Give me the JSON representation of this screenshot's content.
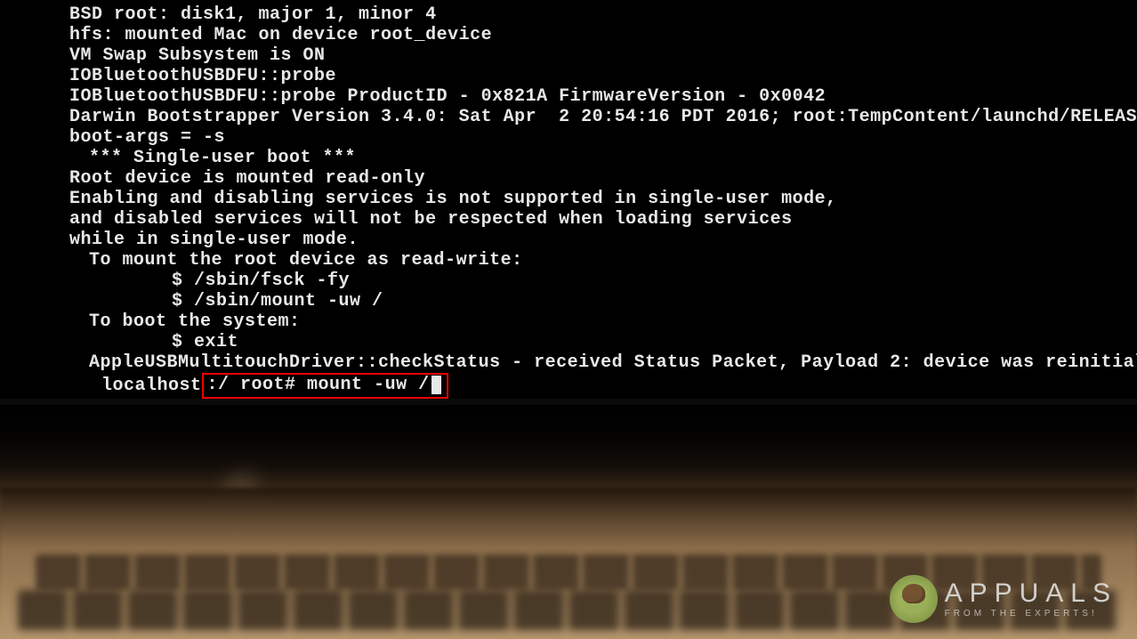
{
  "terminal": {
    "lines": [
      "BSD root: disk1, major 1, minor 4",
      "hfs: mounted Mac on device root_device",
      "VM Swap Subsystem is ON",
      "IOBluetoothUSBDFU::probe",
      "IOBluetoothUSBDFU::probe ProductID - 0x821A FirmwareVersion - 0x0042",
      "Darwin Bootstrapper Version 3.4.0: Sat Apr  2 20:54:16 PDT 2016; root:TempContent/launchd/RELEASE_X",
      "boot-args = -s",
      "*** Single-user boot ***",
      "Root device is mounted read-only",
      "Enabling and disabling services is not supported in single-user mode,",
      "and disabled services will not be respected when loading services",
      "while in single-user mode.",
      "To mount the root device as read-write:",
      "$ /sbin/fsck -fy",
      "$ /sbin/mount -uw /",
      "To boot the system:",
      "$ exit",
      "AppleUSBMultitouchDriver::checkStatus - received Status Packet, Payload 2: device was reinitialized"
    ],
    "prompt_prefix": "localhost",
    "prompt_box": ":/ root# mount -uw /"
  },
  "watermark": {
    "brand": "APPUALS",
    "tagline": "FROM THE EXPERTS!"
  }
}
